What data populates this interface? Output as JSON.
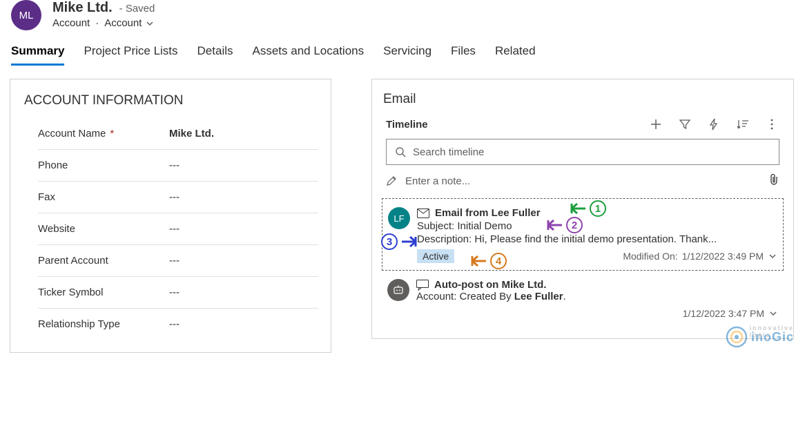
{
  "header": {
    "avatar_initials": "ML",
    "title": "Mike Ltd.",
    "saved_label": "- Saved",
    "entity_label": "Account",
    "form_label": "Account"
  },
  "tabs": [
    {
      "label": "Summary",
      "active": true
    },
    {
      "label": "Project Price Lists"
    },
    {
      "label": "Details"
    },
    {
      "label": "Assets and Locations"
    },
    {
      "label": "Servicing"
    },
    {
      "label": "Files"
    },
    {
      "label": "Related"
    }
  ],
  "account_info": {
    "section_title": "ACCOUNT INFORMATION",
    "fields": [
      {
        "label": "Account Name",
        "required": true,
        "value": "Mike Ltd."
      },
      {
        "label": "Phone",
        "value": "---"
      },
      {
        "label": "Fax",
        "value": "---"
      },
      {
        "label": "Website",
        "value": "---"
      },
      {
        "label": "Parent Account",
        "value": "---"
      },
      {
        "label": "Ticker Symbol",
        "value": "---"
      },
      {
        "label": "Relationship Type",
        "value": "---"
      }
    ]
  },
  "email_panel": {
    "title": "Email",
    "timeline_label": "Timeline",
    "search_placeholder": "Search timeline",
    "note_placeholder": "Enter a note..."
  },
  "timeline": {
    "item1": {
      "avatar": "LF",
      "title": "Email from Lee Fuller",
      "subject_prefix": "Subject: ",
      "subject": "Initial Demo",
      "desc_prefix": "Description: ",
      "desc": "Hi, Please find the initial demo presentation. Thank...",
      "status": "Active",
      "modified_label": "Modified On: ",
      "modified_value": "1/12/2022 3:49 PM"
    },
    "item2": {
      "title": "Auto-post on Mike Ltd.",
      "line_prefix": "Account: Created By ",
      "sender": "Lee Fuller",
      "line_suffix": ".",
      "timestamp": "1/12/2022 3:47 PM"
    }
  },
  "annotations": {
    "marker1": "1",
    "marker2": "2",
    "marker3": "3",
    "marker4": "4"
  },
  "watermark": {
    "brand": "inoGic",
    "tagline": "innovative logic"
  }
}
